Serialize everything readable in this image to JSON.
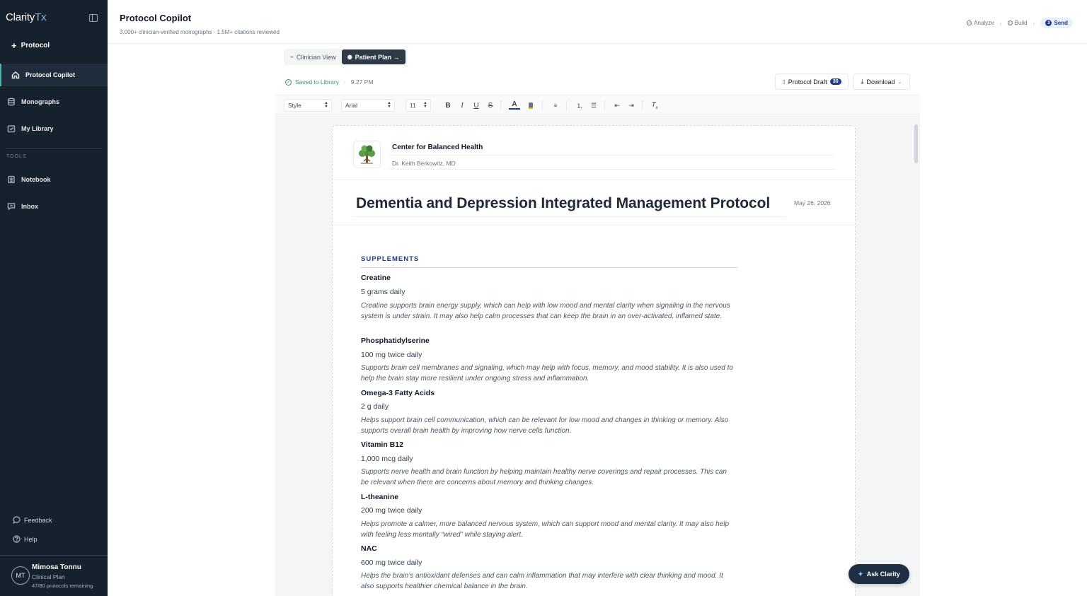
{
  "app": {
    "logo_main": "Clarity",
    "logo_accent": "Tx"
  },
  "sidebar": {
    "new_protocol": "Protocol",
    "items": [
      {
        "label": "Protocol Copilot",
        "icon": "home-icon"
      },
      {
        "label": "Monographs",
        "icon": "database-icon"
      },
      {
        "label": "My Library",
        "icon": "library-icon"
      }
    ],
    "tools_label": "TOOLS",
    "tools": [
      {
        "label": "Notebook",
        "icon": "notebook-icon"
      },
      {
        "label": "Inbox",
        "icon": "chat-icon"
      }
    ],
    "footer": [
      {
        "label": "Feedback",
        "icon": "feedback-icon"
      },
      {
        "label": "Help",
        "icon": "help-icon"
      }
    ],
    "user": {
      "initials": "MT",
      "name": "Mimosa Tonnu",
      "plan": "Clinical Plan",
      "remaining": "47/80 protocols remaining"
    }
  },
  "header": {
    "title": "Protocol Copilot",
    "subtitle": "3,000+ clinician-verified monographs · 1.5M+ citations reviewed",
    "steps": [
      {
        "label": "Analyze",
        "state": "done"
      },
      {
        "label": "Build",
        "state": "done"
      },
      {
        "label": "Send",
        "state": "active",
        "number": "3"
      }
    ]
  },
  "view_toggle": {
    "clinician": "Clinician View",
    "patient": "Patient Plan →",
    "active": "patient"
  },
  "status": {
    "saved": "Saved to Library",
    "time": "9:27 PM"
  },
  "actions": {
    "draft_label": "Protocol Draft",
    "draft_count": "30",
    "download_label": "Download"
  },
  "toolbar": {
    "style": "Style",
    "font": "Arial",
    "size": "11",
    "bold": "B",
    "italic": "I",
    "underline": "U",
    "strike": "S"
  },
  "document": {
    "clinic_name": "Center for Balanced Health",
    "doctor": "Dr. Keith Berkowitz, MD",
    "title": "Dementia and Depression Integrated Management Protocol",
    "date": "May 26, 2026",
    "section": "SUPPLEMENTS",
    "supplements": [
      {
        "name": "Creatine",
        "dose": "5 grams daily",
        "desc": "Creatine supports brain energy supply, which can help with low mood and mental clarity when signaling in the nervous system is under strain. It may also help calm processes that can keep the brain in an over-activated, inflamed state."
      },
      {
        "name": "Phosphatidylserine",
        "dose": "100 mg twice daily",
        "desc": "Supports brain cell membranes and signaling, which may help with focus, memory, and mood stability. It is also used to help the brain stay more resilient under ongoing stress and inflammation."
      },
      {
        "name": "Omega-3 Fatty Acids",
        "dose": "2 g daily",
        "desc": "Helps support brain cell communication, which can be relevant for low mood and changes in thinking or memory. Also supports overall brain health by improving how nerve cells function."
      },
      {
        "name": "Vitamin B12",
        "dose": "1,000 mcg daily",
        "desc": "Supports nerve health and brain function by helping maintain healthy nerve coverings and repair processes. This can be relevant when there are concerns about memory and thinking changes."
      },
      {
        "name": "L-theanine",
        "dose": "200 mg twice daily",
        "desc": "Helps promote a calmer, more balanced nervous system, which can support mood and mental clarity. It may also help with feeling less mentally “wired” while staying alert."
      },
      {
        "name": "NAC",
        "dose": "600 mg twice daily",
        "desc": "Helps the brain’s antioxidant defenses and can calm inflammation that may interfere with clear thinking and mood. It also supports healthier chemical balance in the brain."
      }
    ]
  },
  "ask": {
    "label": "Ask Clarity"
  },
  "colors": {
    "sidebar_bg": "#16212e",
    "accent": "#1e3a8a",
    "success": "#3f8f6a",
    "active_marker": "#4fb3a9"
  }
}
